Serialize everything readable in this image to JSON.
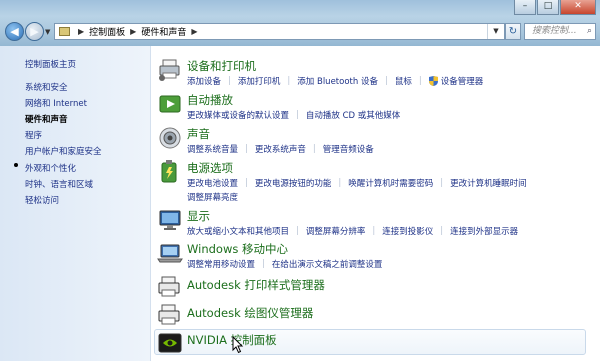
{
  "window": {
    "controls": {
      "minimize": "–",
      "maximize": "□",
      "close": "✕"
    }
  },
  "nav": {
    "back_glyph": "◀",
    "forward_glyph": "▶",
    "dropdown_glyph": "▼"
  },
  "address": {
    "breadcrumb": [
      "控制面板",
      "硬件和声音"
    ],
    "separator": "▶",
    "dropdown_glyph": "▼",
    "refresh_glyph": "↻"
  },
  "search": {
    "placeholder": "搜索控制...",
    "icon": "search-icon",
    "glyph": "⌕"
  },
  "sidebar": {
    "items": [
      {
        "label": "控制面板主页"
      },
      {
        "label": "系统和安全"
      },
      {
        "label": "网络和 Internet"
      },
      {
        "label": "硬件和声音",
        "current": true
      },
      {
        "label": "程序"
      },
      {
        "label": "用户帐户和家庭安全"
      },
      {
        "label": "外观和个性化"
      },
      {
        "label": "时钟、语言和区域"
      },
      {
        "label": "轻松访问"
      }
    ]
  },
  "categories": [
    {
      "title": "设备和打印机",
      "icon": "devices-printers-icon",
      "links": [
        "添加设备",
        "添加打印机",
        "添加 Bluetooth 设备",
        "鼠标",
        "设备管理器"
      ],
      "links_line2": []
    },
    {
      "title": "自动播放",
      "icon": "autoplay-icon",
      "links": [
        "更改媒体或设备的默认设置",
        "自动播放 CD 或其他媒体"
      ],
      "links_line2": []
    },
    {
      "title": "声音",
      "icon": "sound-icon",
      "links": [
        "调整系统音量",
        "更改系统声音",
        "管理音频设备"
      ],
      "links_line2": []
    },
    {
      "title": "电源选项",
      "icon": "power-options-icon",
      "links": [
        "更改电池设置",
        "更改电源按钮的功能",
        "唤醒计算机时需要密码",
        "更改计算机睡眠时间"
      ],
      "links_line2": [
        "调整屏幕亮度"
      ]
    },
    {
      "title": "显示",
      "icon": "display-icon",
      "links": [
        "放大或缩小文本和其他项目",
        "调整屏幕分辨率",
        "连接到投影仪",
        "连接到外部显示器"
      ],
      "links_line2": []
    },
    {
      "title": "Windows 移动中心",
      "icon": "mobility-center-icon",
      "links": [
        "调整常用移动设置",
        "在给出演示文稿之前调整设置"
      ],
      "links_line2": []
    },
    {
      "title": "Autodesk 打印样式管理器",
      "icon": "autodesk-plot-style-icon",
      "links": [],
      "links_line2": []
    },
    {
      "title": "Autodesk 绘图仪管理器",
      "icon": "autodesk-plotter-icon",
      "links": [],
      "links_line2": []
    },
    {
      "title": "NVIDIA 控制面板",
      "icon": "nvidia-icon",
      "links": [],
      "links_line2": [],
      "hovered": true
    }
  ],
  "colors": {
    "title_green": "#1c6e1c",
    "link_blue": "#1e3287",
    "sidebar_bg": "#dbe7f5"
  }
}
